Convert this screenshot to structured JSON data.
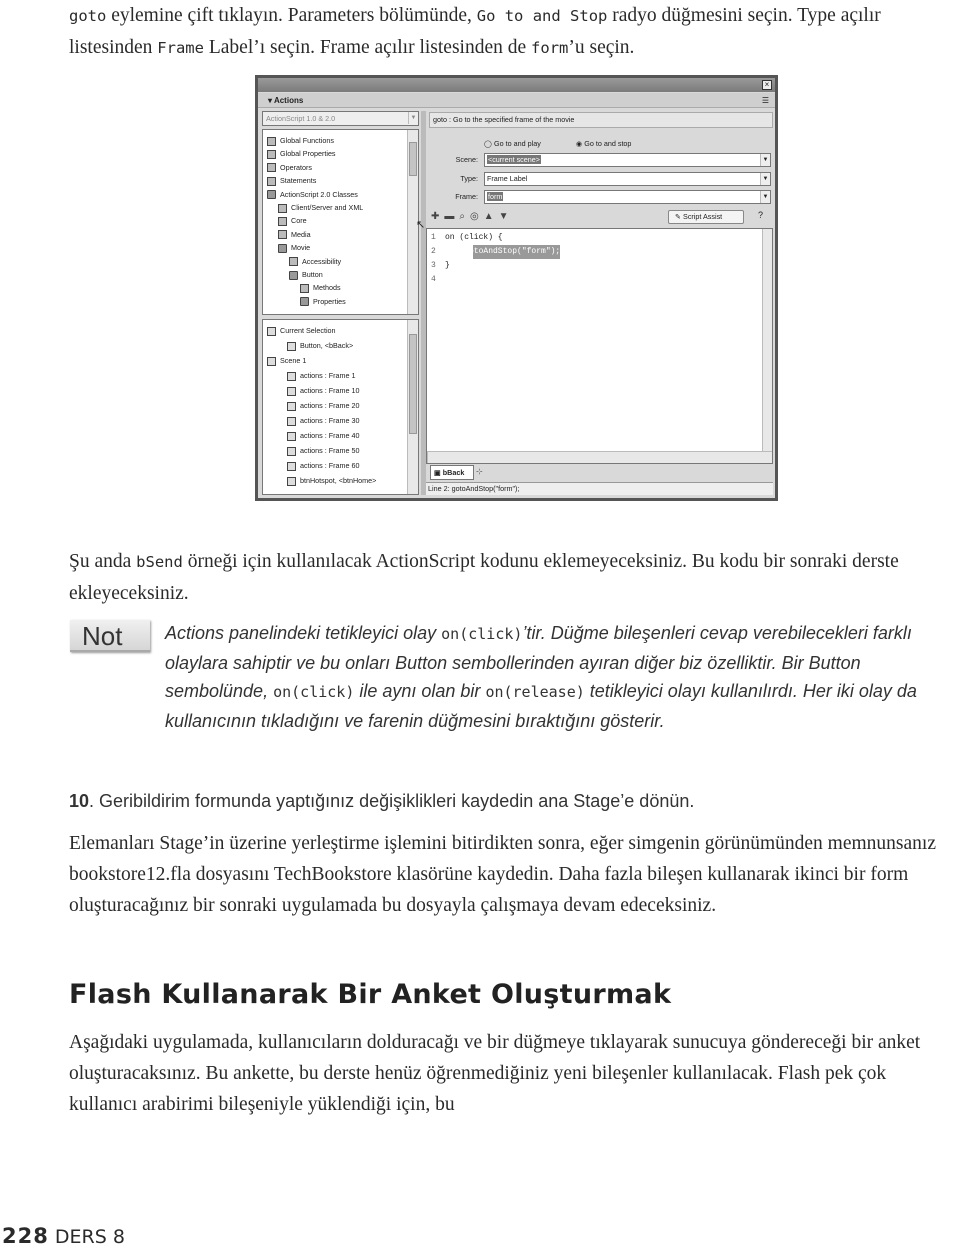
{
  "para1": {
    "t1": "goto",
    "t2": " eylemine çift tıklayın. Parameters bölümünde, ",
    "t3": "Go to and Stop",
    "t4": " radyo düğmesini seçin. Type açılır listesinden ",
    "t5": "Frame",
    "t6": " Label’ı seçin. Frame açılır listesinden de ",
    "t7": "form",
    "t8": "’u seçin."
  },
  "screenshot": {
    "panel_title": "Actions",
    "close_icon": "close-icon",
    "version": "ActionScript 1.0 & 2.0",
    "tree": [
      {
        "label": "Global Functions",
        "level": 0,
        "icon": "arrow"
      },
      {
        "label": "Global Properties",
        "level": 0,
        "icon": "arrow"
      },
      {
        "label": "Operators",
        "level": 0,
        "icon": "arrow"
      },
      {
        "label": "Statements",
        "level": 0,
        "icon": "arrow"
      },
      {
        "label": "ActionScript 2.0 Classes",
        "level": 0,
        "icon": "book"
      },
      {
        "label": "Client/Server and XML",
        "level": 1,
        "icon": "arrow"
      },
      {
        "label": "Core",
        "level": 1,
        "icon": "arrow"
      },
      {
        "label": "Media",
        "level": 1,
        "icon": "arrow"
      },
      {
        "label": "Movie",
        "level": 1,
        "icon": "book"
      },
      {
        "label": "Accessibility",
        "level": 2,
        "icon": "arrow"
      },
      {
        "label": "Button",
        "level": 2,
        "icon": "book"
      },
      {
        "label": "Methods",
        "level": 3,
        "icon": "arrow"
      },
      {
        "label": "Properties",
        "level": 3,
        "icon": "book"
      }
    ],
    "selection_tree": [
      {
        "label": "Current Selection",
        "level": 0
      },
      {
        "label": "Button, <bBack>",
        "level": 1
      },
      {
        "label": "Scene 1",
        "level": 0
      },
      {
        "label": "actions : Frame 1",
        "level": 1
      },
      {
        "label": "actions : Frame 10",
        "level": 1
      },
      {
        "label": "actions : Frame 20",
        "level": 1
      },
      {
        "label": "actions : Frame 30",
        "level": 1
      },
      {
        "label": "actions : Frame 40",
        "level": 1
      },
      {
        "label": "actions : Frame 50",
        "level": 1
      },
      {
        "label": "actions : Frame 60",
        "level": 1
      },
      {
        "label": "btnHotspot, <btnHome>",
        "level": 1
      }
    ],
    "description": "goto : Go to the specified frame of the movie",
    "radio_play": "Go to and play",
    "radio_stop": "Go to and stop",
    "radio_selected": "Go to and stop",
    "scene_label": "Scene:",
    "scene_value": "<current scene>",
    "type_label": "Type:",
    "type_value": "Frame Label",
    "frame_label": "Frame:",
    "frame_value": "form",
    "script_assist": "Script Assist",
    "code": [
      {
        "num": "1",
        "text": "on (click) {"
      },
      {
        "num": "2",
        "text": "    gotoAndStop(\"form\");"
      },
      {
        "num": "3",
        "text": "}"
      },
      {
        "num": "4",
        "text": ""
      }
    ],
    "tab": "bBack",
    "status": "Line 2: gotoAndStop(\"form\");"
  },
  "para2": {
    "t1": "Şu anda ",
    "t2": "bSend",
    "t3": " örneği için kullanılacak ActionScript kodunu eklemeyeceksiniz. Bu kodu bir sonraki derste ekleyeceksiniz."
  },
  "note": {
    "badge": "Not",
    "t1": "Actions panelindeki tetikleyici olay ",
    "c1": "on(click)",
    "t2": "’tir. Düğme bileşenleri cevap verebilecekleri farklı olaylara sahiptir ve bu onları Button sembollerinden ayıran diğer biz özelliktir. Bir Button sembolünde, ",
    "c2": "on(click)",
    "t3": " ile aynı olan bir ",
    "c3": "on(release)",
    "t4": " tetikleyici olayı kullanılırdı. Her iki olay da kullanıcının tıkladığını ve farenin düğmesini bıraktığını gösterir."
  },
  "step10": {
    "num": "10",
    "text": ". Geribildirim formunda yaptığınız değişiklikleri kaydedin ana Stage’e dönün."
  },
  "para3": "Elemanları Stage’in üzerine yerleştirme işlemini bitirdikten sonra, eğer simgenin görünümünden memnunsanız bookstore12.fla dosyasını TechBookstore klasörüne kaydedin. Daha fazla bileşen kullanarak ikinci bir form oluşturacağınız bir sonraki uygulamada bu dosyayla çalışmaya devam edeceksiniz.",
  "heading": "Flash Kullanarak Bir Anket Oluşturmak",
  "para4": "Aşağıdaki uygulamada, kullanıcıların dolduracağı ve bir düğmeye tıklayarak sunucuya göndereceği bir anket oluşturacaksınız. Bu ankette, bu derste henüz öğrenmediğiniz yeni bileşenler kullanılacak. Flash pek çok kullanıcı arabirimi bileşeniyle yüklendiği için, bu",
  "footer": {
    "page": "228",
    "lesson": "DERS 8"
  }
}
